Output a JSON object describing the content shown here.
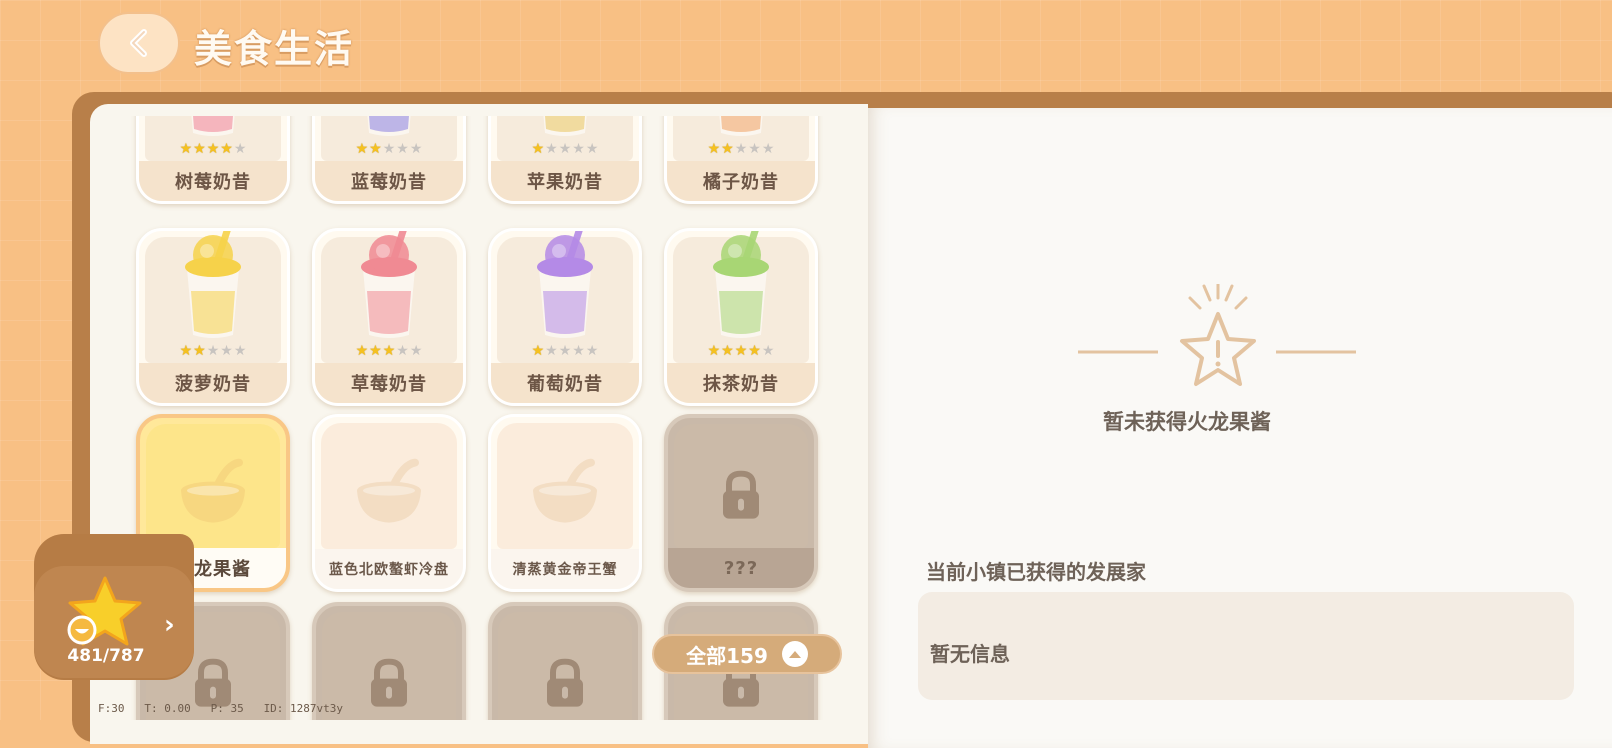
{
  "header": {
    "title": "美食生活",
    "back_icon": "chevron-left-icon"
  },
  "grid": {
    "rows": [
      [
        {
          "name": "树莓奶昔",
          "stars": 4,
          "color": "#f07f93"
        },
        {
          "name": "蓝莓奶昔",
          "stars": 2,
          "color": "#8b7fe0"
        },
        {
          "name": "苹果奶昔",
          "stars": 1,
          "color": "#e9c45c"
        },
        {
          "name": "橘子奶昔",
          "stars": 2,
          "color": "#f0a060"
        }
      ],
      [
        {
          "name": "菠萝奶昔",
          "stars": 2,
          "color": "#f6d24a"
        },
        {
          "name": "草莓奶昔",
          "stars": 3,
          "color": "#f08a93"
        },
        {
          "name": "葡萄奶昔",
          "stars": 1,
          "color": "#b48ae6"
        },
        {
          "name": "抹茶奶昔",
          "stars": 4,
          "color": "#a8d674"
        }
      ],
      [
        {
          "name": "火龙果酱",
          "state": "selected"
        },
        {
          "name": "蓝色北欧螯虾冷盘",
          "state": "ghost"
        },
        {
          "name": "清蒸黄金帝王蟹",
          "state": "ghost"
        },
        {
          "name": "???",
          "state": "locked"
        }
      ]
    ],
    "max_stars": 5
  },
  "collection_tab": {
    "count": "481/787",
    "icon": "star-icon",
    "arrow_icon": "chevron-right-icon"
  },
  "filter": {
    "label": "全部159",
    "icon": "chevron-up-icon"
  },
  "detail": {
    "status": "暂未获得火龙果酱",
    "section_heading": "当前小镇已获得的发展家",
    "info": "暂无信息"
  },
  "debug": {
    "text": "F:30   T: 0.00   P: 35   ID: 1287vt3y"
  },
  "colors": {
    "background": "#f8c084",
    "book": "#b87f49",
    "page": "#f9f6ee",
    "star": "#f5c120"
  }
}
